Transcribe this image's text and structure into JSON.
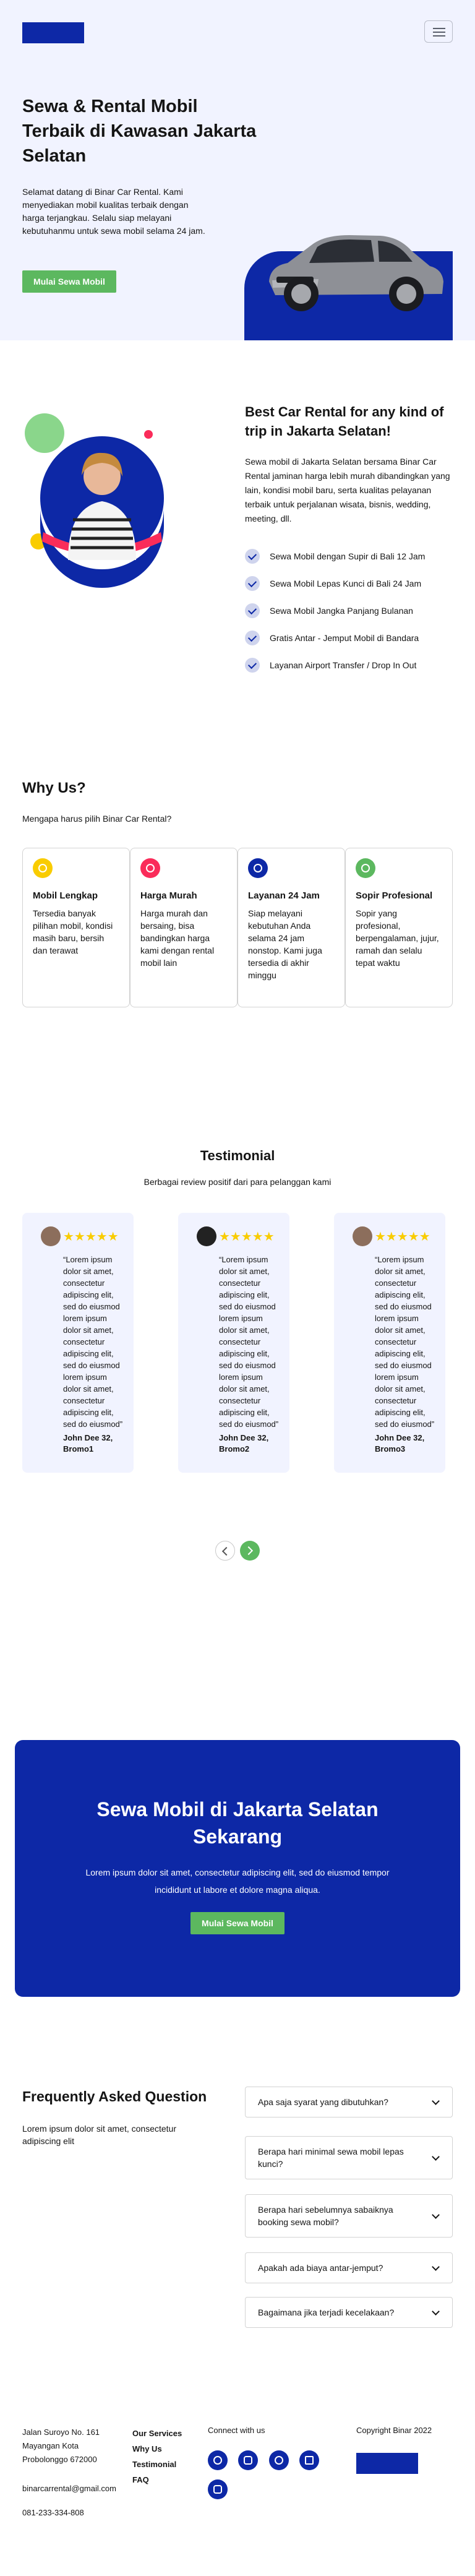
{
  "hero": {
    "title": "Sewa & Rental Mobil Terbaik di Kawasan Jakarta Selatan",
    "description": "Selamat datang di Binar Car Rental. Kami menyediakan mobil kualitas terbaik dengan harga terjangkau. Selalu siap melayani kebutuhanmu untuk sewa mobil selama 24 jam.",
    "cta_label": "Mulai Sewa Mobil"
  },
  "services": {
    "title": "Best Car Rental for any kind of trip in Jakarta Selatan!",
    "description": "Sewa mobil di Jakarta Selatan bersama Binar Car Rental jaminan harga lebih murah dibandingkan yang lain, kondisi mobil baru, serta kualitas pelayanan terbaik untuk perjalanan wisata, bisnis, wedding, meeting, dll.",
    "items": [
      "Sewa Mobil dengan Supir di Bali 12 Jam",
      "Sewa Mobil Lepas Kunci di Bali 24 Jam",
      "Sewa Mobil Jangka Panjang Bulanan",
      "Gratis Antar - Jemput Mobil di Bandara",
      "Layanan Airport Transfer / Drop In Out"
    ]
  },
  "why": {
    "title": "Why Us?",
    "subtitle": "Mengapa harus pilih Binar Car Rental?",
    "cards": [
      {
        "title": "Mobil Lengkap",
        "text": "Tersedia banyak pilihan mobil, kondisi masih baru, bersih dan terawat",
        "color": "#F9CC00",
        "icon": "thumbs-up-icon"
      },
      {
        "title": "Harga Murah",
        "text": "Harga murah dan bersaing, bisa bandingkan harga kami dengan rental mobil lain",
        "color": "#FA2C5A",
        "icon": "tag-icon"
      },
      {
        "title": "Layanan 24 Jam",
        "text": "Siap melayani kebutuhan Anda selama 24 jam nonstop. Kami juga tersedia di akhir minggu",
        "color": "#0D28A6",
        "icon": "clock-icon"
      },
      {
        "title": "Sopir Profesional",
        "text": "Sopir yang profesional, berpengalaman, jujur, ramah dan selalu tepat waktu",
        "color": "#5CB85F",
        "icon": "award-icon"
      }
    ]
  },
  "testimonial": {
    "title": "Testimonial",
    "subtitle": "Berbagai review positif dari para pelanggan kami",
    "stars": "★★★★★",
    "cards": [
      {
        "quote": "“Lorem ipsum dolor sit amet, consectetur adipiscing elit, sed do eiusmod lorem ipsum dolor sit amet, consectetur adipiscing elit, sed do eiusmod lorem ipsum dolor sit amet, consectetur adipiscing elit, sed do eiusmod”",
        "author": "John Dee 32, Bromo1"
      },
      {
        "quote": "“Lorem ipsum dolor sit amet, consectetur adipiscing elit, sed do eiusmod lorem ipsum dolor sit amet, consectetur adipiscing elit, sed do eiusmod lorem ipsum dolor sit amet, consectetur adipiscing elit, sed do eiusmod”",
        "author": "John Dee 32, Bromo2"
      },
      {
        "quote": "“Lorem ipsum dolor sit amet, consectetur adipiscing elit, sed do eiusmod lorem ipsum dolor sit amet, consectetur adipiscing elit, sed do eiusmod lorem ipsum dolor sit amet, consectetur adipiscing elit, sed do eiusmod”",
        "author": "John Dee 32, Bromo3"
      }
    ]
  },
  "cta": {
    "title": "Sewa Mobil di Jakarta Selatan Sekarang",
    "description": "Lorem ipsum dolor sit amet, consectetur adipiscing elit, sed do eiusmod tempor incididunt ut labore et dolore magna aliqua.",
    "button": "Mulai Sewa Mobil"
  },
  "faq": {
    "title": "Frequently Asked Question",
    "subtitle": "Lorem ipsum dolor sit amet, consectetur adipiscing elit",
    "items": [
      "Apa saja syarat yang dibutuhkan?",
      "Berapa hari minimal sewa mobil lepas kunci?",
      "Berapa hari sebelumnya sabaiknya booking sewa mobil?",
      "Apakah ada biaya antar-jemput?",
      "Bagaimana jika terjadi kecelakaan?"
    ]
  },
  "footer": {
    "address": "Jalan Suroyo No. 161 Mayangan Kota Probolonggo 672000",
    "email": "binarcarrental@gmail.com",
    "phone": "081-233-334-808",
    "links": [
      "Our Services",
      "Why Us",
      "Testimonial",
      "FAQ"
    ],
    "connect": "Connect with us",
    "copyright": "Copyright Binar 2022",
    "socials": [
      "facebook-icon",
      "instagram-icon",
      "twitter-icon",
      "mail-icon",
      "twitch-icon"
    ]
  },
  "colors": {
    "primary": "#0D28A6",
    "accent_green": "#5CB85F",
    "hero_bg": "#F1F3FF"
  }
}
